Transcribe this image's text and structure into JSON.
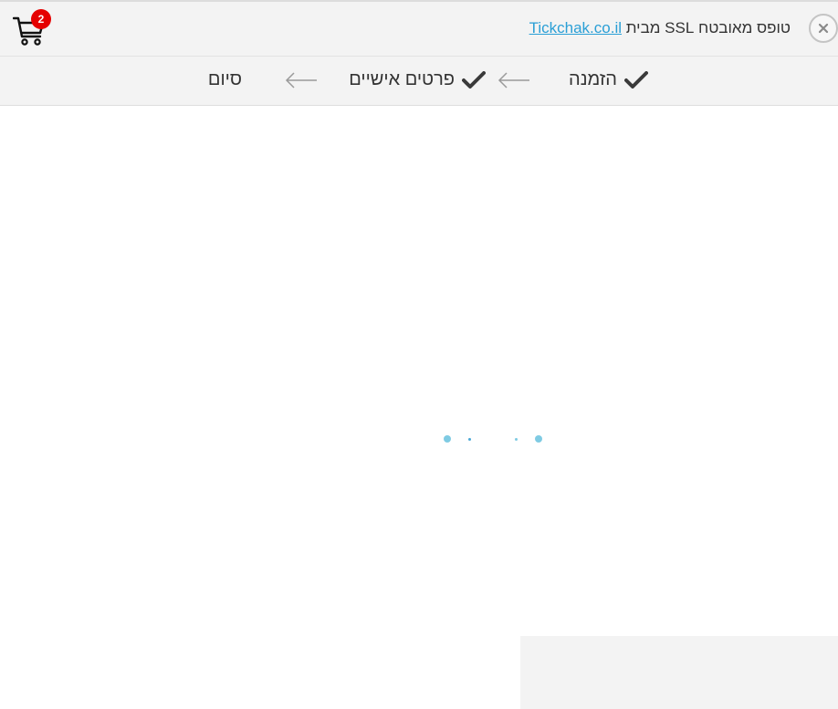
{
  "header": {
    "secure_text": "טופס מאובטח SSL מבית",
    "secure_link": "Tickchak.co.il",
    "cart_count": "2",
    "close_label": "×"
  },
  "steps": [
    {
      "label": "הזמנה",
      "completed": true
    },
    {
      "label": "פרטים אישיים",
      "completed": true
    },
    {
      "label": "סיום",
      "completed": false
    }
  ],
  "icons": {
    "close": "close-icon",
    "cart": "cart-icon",
    "check": "check-icon",
    "arrow": "arrow-left-icon"
  },
  "colors": {
    "link": "#2a9fd6",
    "badge": "#e50000",
    "loader": "#7fcbe3",
    "bar": "#f3f3f3"
  }
}
